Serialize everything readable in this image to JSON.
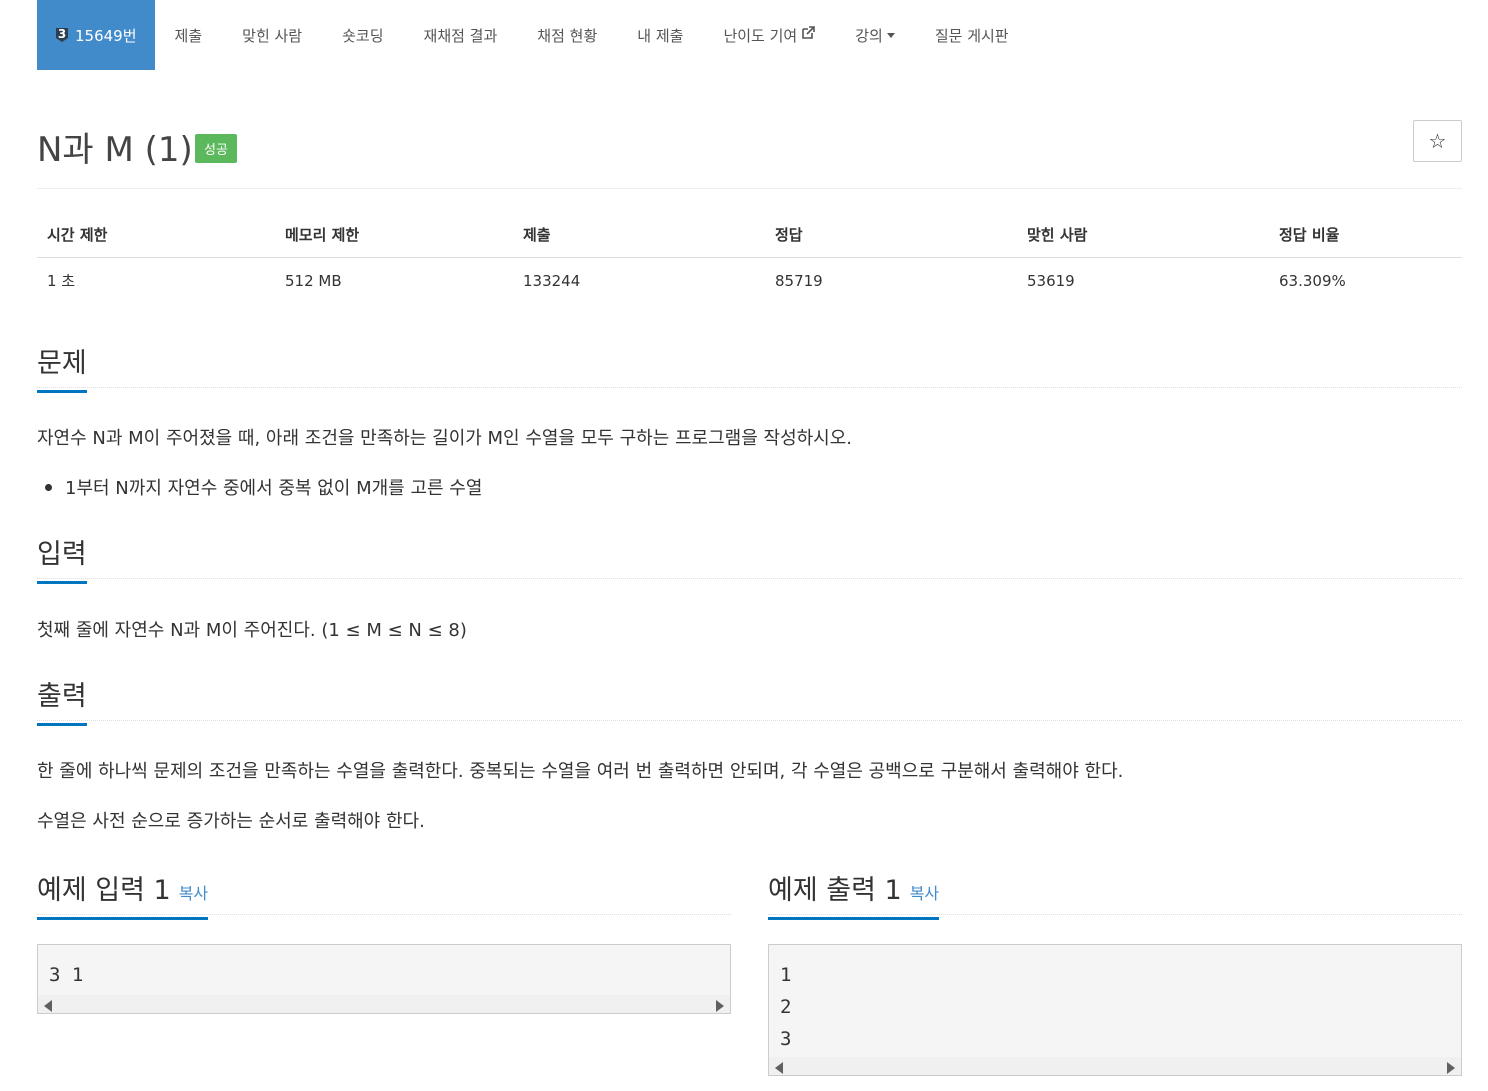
{
  "nav": {
    "problem_tier": "3",
    "problem_label": "15649번",
    "items": [
      "제출",
      "맞힌 사람",
      "숏코딩",
      "재채점 결과",
      "채점 현황",
      "내 제출",
      "난이도 기여",
      "강의",
      "질문 게시판"
    ]
  },
  "problem": {
    "title": "N과 M (1)",
    "result_label": "성공",
    "star_icon": "☆"
  },
  "info_table": {
    "headers": [
      "시간 제한",
      "메모리 제한",
      "제출",
      "정답",
      "맞힌 사람",
      "정답 비율"
    ],
    "values": [
      "1 초",
      "512 MB",
      "133244",
      "85719",
      "53619",
      "63.309%"
    ]
  },
  "sections": {
    "description": {
      "title": "문제",
      "text": "자연수 N과 M이 주어졌을 때, 아래 조건을 만족하는 길이가 M인 수열을 모두 구하는 프로그램을 작성하시오.",
      "bullets": [
        "1부터 N까지 자연수 중에서 중복 없이 M개를 고른 수열"
      ]
    },
    "input": {
      "title": "입력",
      "text": "첫째 줄에 자연수 N과 M이 주어진다. (1 ≤ M ≤ N ≤ 8)"
    },
    "output": {
      "title": "출력",
      "paragraphs": [
        "한 줄에 하나씩 문제의 조건을 만족하는 수열을 출력한다. 중복되는 수열을 여러 번 출력하면 안되며, 각 수열은 공백으로 구분해서 출력해야 한다.",
        "수열은 사전 순으로 증가하는 순서로 출력해야 한다."
      ]
    }
  },
  "samples": {
    "input": {
      "title": "예제 입력 1",
      "copy": "복사",
      "content": "3 1"
    },
    "output": {
      "title": "예제 출력 1",
      "copy": "복사",
      "content": "1\n2\n3"
    }
  },
  "colors": {
    "active_nav": "#428bca",
    "success": "#5cb85c",
    "section_underline": "#0076c0",
    "link": "#428bca"
  }
}
